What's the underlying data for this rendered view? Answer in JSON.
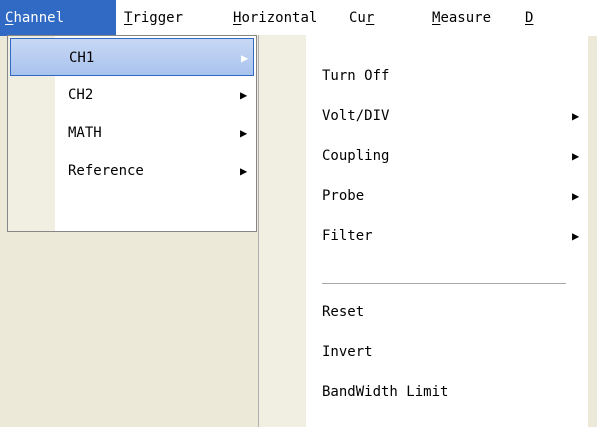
{
  "menubar": {
    "items": [
      {
        "label": "Channel",
        "shortcut": "C"
      },
      {
        "label": "Trigger",
        "shortcut": "T"
      },
      {
        "label": "Horizontal",
        "shortcut": "H"
      },
      {
        "label": "Cursor",
        "shortcut": "r"
      },
      {
        "label": "Measure",
        "shortcut": "M"
      },
      {
        "label": "D"
      }
    ],
    "active": "Channel"
  },
  "channel_menu": {
    "items": [
      {
        "label": "CH1",
        "has_submenu": true,
        "selected": true
      },
      {
        "label": "CH2",
        "has_submenu": true
      },
      {
        "label": "MATH",
        "has_submenu": true
      },
      {
        "label": "Reference",
        "has_submenu": true
      }
    ]
  },
  "ch1_submenu": {
    "items": [
      {
        "label": "Turn Off"
      },
      {
        "label": "Volt/DIV",
        "has_submenu": true
      },
      {
        "label": "Coupling",
        "has_submenu": true
      },
      {
        "label": "Probe",
        "has_submenu": true
      },
      {
        "label": "Filter",
        "has_submenu": true
      },
      {
        "label": "Reset"
      },
      {
        "label": "Invert"
      },
      {
        "label": "BandWidth Limit"
      }
    ]
  },
  "icons": {
    "submenu_arrow": "▶"
  },
  "colors": {
    "menubar_bg": "#ffffff",
    "active_menu_bg": "#316ac5",
    "selected_item_border": "#316ac5",
    "icon_strip": "#f1efe2",
    "desktop_bg": "#ece9d8"
  }
}
